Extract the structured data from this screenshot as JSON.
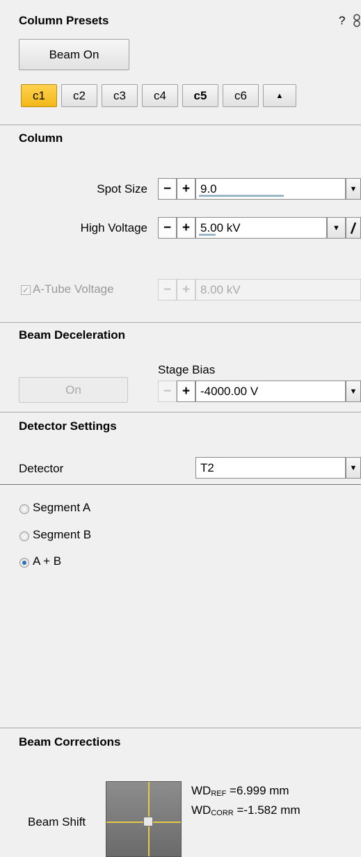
{
  "column_presets": {
    "title": "Column Presets",
    "help_glyph": "?",
    "beam_button": "Beam On",
    "presets": [
      {
        "label": "c1",
        "active": true,
        "bold": false
      },
      {
        "label": "c2",
        "active": false,
        "bold": false
      },
      {
        "label": "c3",
        "active": false,
        "bold": false
      },
      {
        "label": "c4",
        "active": false,
        "bold": false
      },
      {
        "label": "c5",
        "active": false,
        "bold": true
      },
      {
        "label": "c6",
        "active": false,
        "bold": false
      }
    ],
    "collapse_glyph": "▲"
  },
  "column": {
    "title": "Column",
    "spot_size": {
      "label": "Spot Size",
      "value": "9.0"
    },
    "high_voltage": {
      "label": "High Voltage",
      "value": "5.00 kV"
    },
    "atube_voltage": {
      "label": "A-Tube Voltage",
      "value": "8.00 kV",
      "checked": true,
      "enabled": false
    }
  },
  "beam_deceleration": {
    "title": "Beam Deceleration",
    "on_button": "On",
    "stage_bias": {
      "label": "Stage Bias",
      "value": "-4000.00 V"
    }
  },
  "detector_settings": {
    "title": "Detector Settings",
    "detector_label": "Detector",
    "detector_value": "T2",
    "options": [
      {
        "label": "Segment A",
        "checked": false
      },
      {
        "label": "Segment B",
        "checked": false
      },
      {
        "label": "A + B",
        "checked": true
      }
    ]
  },
  "beam_corrections": {
    "title": "Beam Corrections",
    "beam_shift_label": "Beam Shift",
    "wd_ref": {
      "prefix": "WD",
      "sub": "REF",
      "value": " =6.999 mm"
    },
    "wd_corr": {
      "prefix": "WD",
      "sub": "CORR",
      "value": " =-1.582 mm"
    }
  },
  "glyphs": {
    "minus": "−",
    "plus": "+",
    "dropdown": "▼",
    "check": "✓"
  },
  "colors": {
    "preset_active": "#f3b81a",
    "pad_crosshair": "#e6c94a",
    "value_underline": "#9cb7c8"
  }
}
